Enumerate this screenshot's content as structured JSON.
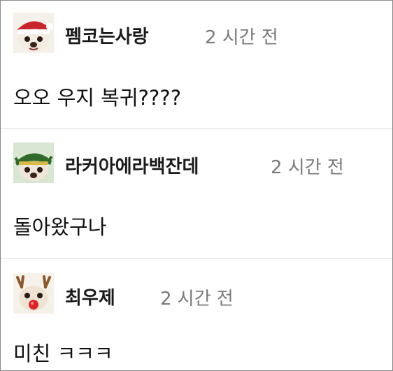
{
  "comments": [
    {
      "avatar_icon": "santa-hat-bear-avatar-icon",
      "author": "펨코는사랑",
      "time": "2 시간 전",
      "text": "오오 우지 복귀????"
    },
    {
      "avatar_icon": "elf-hat-bear-avatar-icon",
      "author": "라커아에라백잔데",
      "time": "2 시간 전",
      "text": "돌아왔구나"
    },
    {
      "avatar_icon": "reindeer-bear-avatar-icon",
      "author": "최우제",
      "time": "2 시간 전",
      "text": "미친 ㅋㅋㅋ"
    }
  ],
  "colors": {
    "author": "#1a1a1a",
    "time": "#7a7a7a",
    "divider": "#dedede",
    "santa_hat": "#c8262c",
    "elf_hat": "#2f6a2a",
    "reindeer_nose": "#d9262c"
  }
}
